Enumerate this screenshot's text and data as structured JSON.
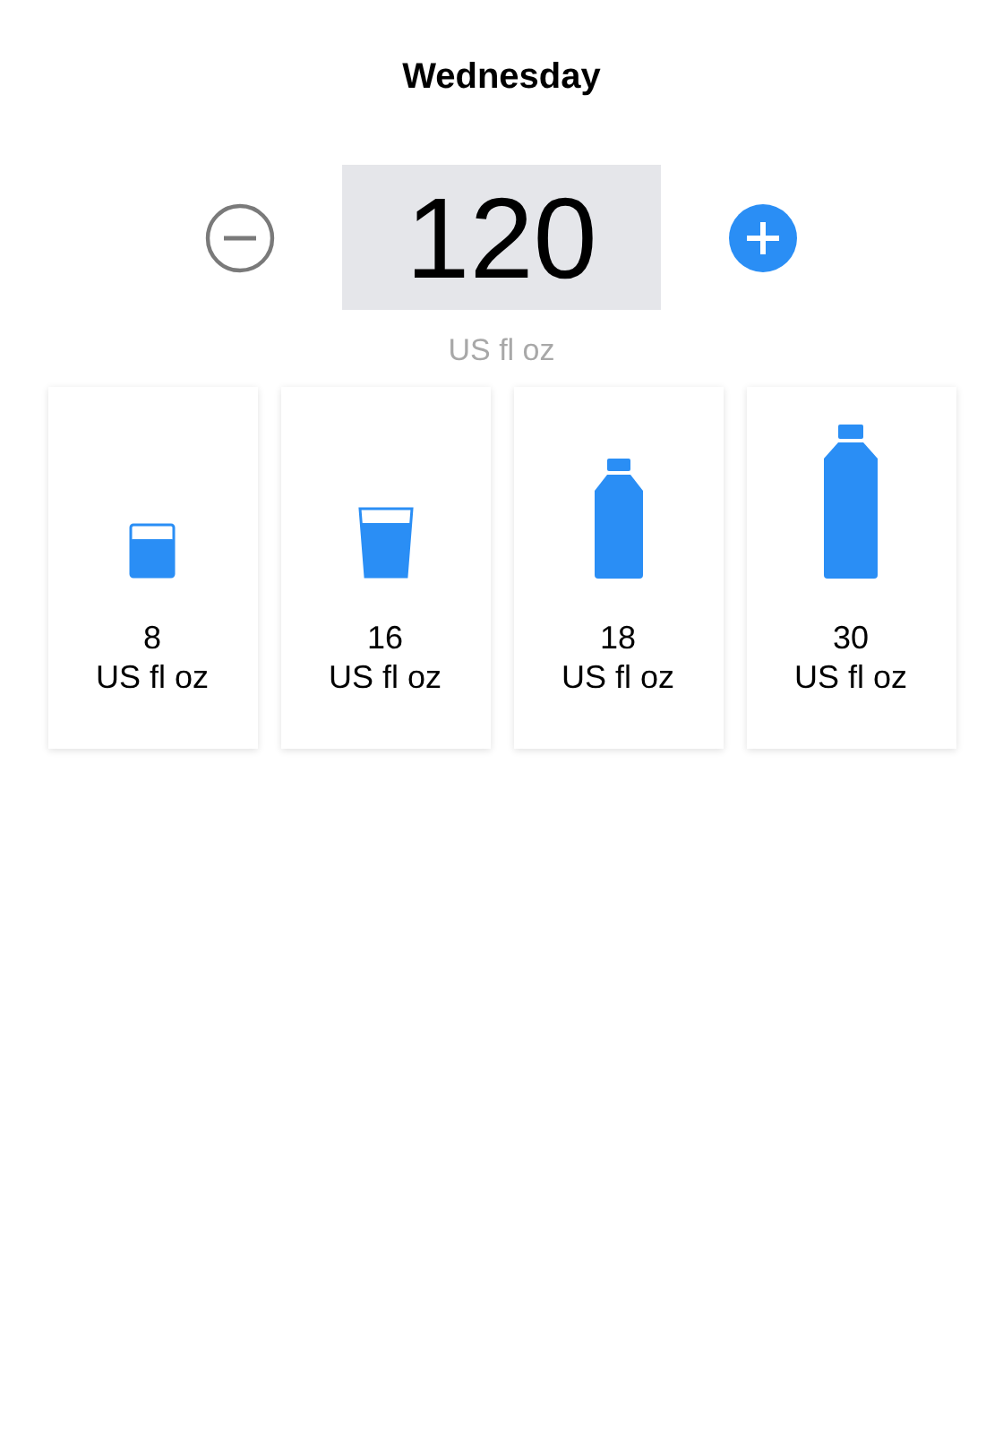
{
  "title": "Wednesday",
  "amount": {
    "value": "120",
    "unit": "US fl oz"
  },
  "presets": [
    {
      "kind": "small-glass",
      "amount": "8",
      "unit": "US fl oz"
    },
    {
      "kind": "large-glass",
      "amount": "16",
      "unit": "US fl oz"
    },
    {
      "kind": "small-bottle",
      "amount": "18",
      "unit": "US fl oz"
    },
    {
      "kind": "large-bottle",
      "amount": "30",
      "unit": "US fl oz"
    }
  ]
}
